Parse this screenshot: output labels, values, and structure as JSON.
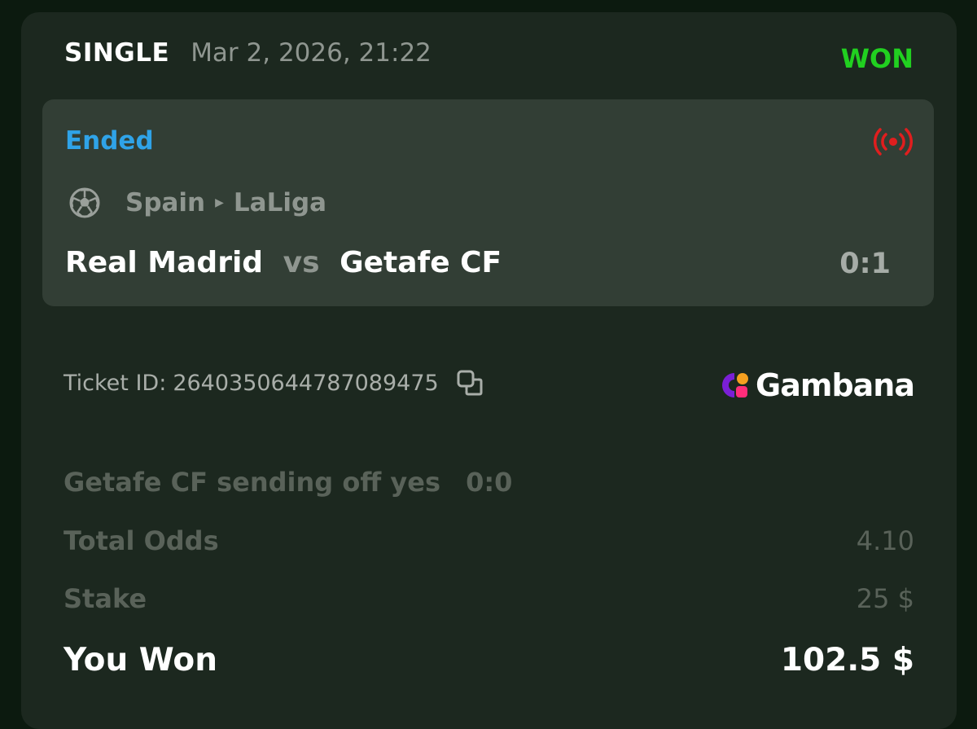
{
  "ticket": {
    "bet_type": "SINGLE",
    "date": "Mar 2, 2026, 21:22",
    "status": "WON",
    "status_color": "#21d020"
  },
  "event": {
    "state": "Ended",
    "live_icon": "live-broadcast-icon",
    "sport_icon": "soccer-ball-icon",
    "country": "Spain",
    "league": "LaLiga",
    "home_team": "Real Madrid",
    "vs": "vs",
    "away_team": "Getafe CF",
    "score": "0:1"
  },
  "ticket_info": {
    "id_label": "Ticket ID:",
    "id": "264035064478708947​5",
    "copy_icon": "copy-icon",
    "brand": "Gambana"
  },
  "selection": {
    "name": "Getafe CF sending off yes",
    "score": "0:0"
  },
  "summary": {
    "total_odds_label": "Total Odds",
    "total_odds": "4.10",
    "stake_label": "Stake",
    "stake": "25 $",
    "won_label": "You Won",
    "won_amount": "102.5 $"
  }
}
